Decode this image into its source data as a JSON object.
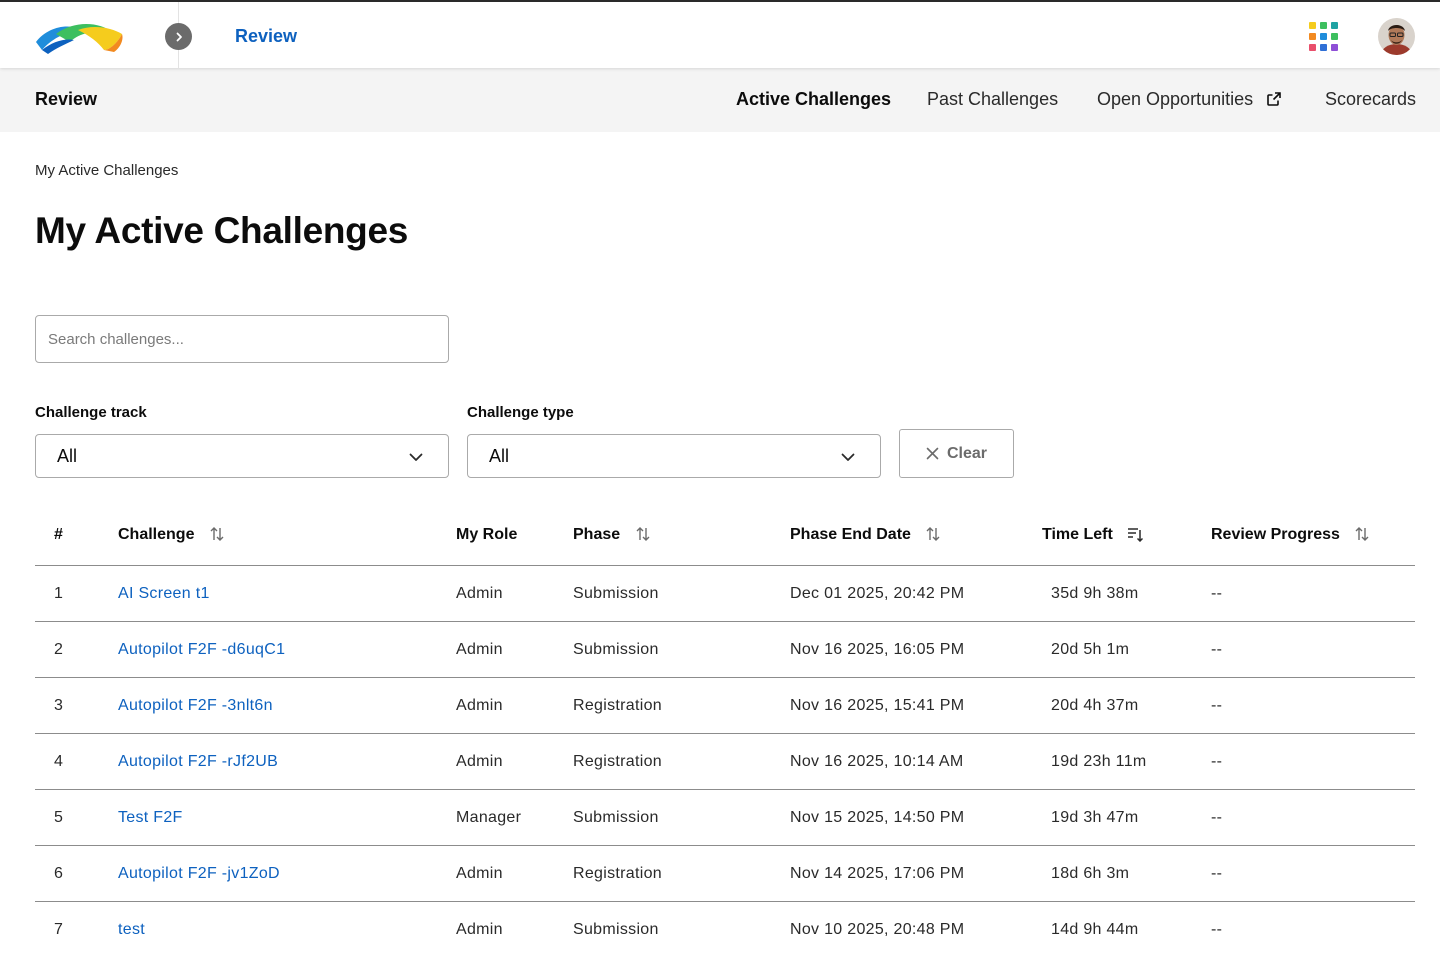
{
  "header": {
    "app_name": "Review",
    "logo": "topcoder-logo",
    "collapse_icon": "chevron-right-icon",
    "apps_icon": "apps-grid-icon",
    "avatar": "user-avatar"
  },
  "subnav": {
    "title": "Review",
    "items": [
      {
        "label": "Active Challenges",
        "active": true
      },
      {
        "label": "Past Challenges",
        "active": false
      },
      {
        "label": "Open Opportunities",
        "active": false,
        "icon": "external-link-icon"
      },
      {
        "label": "Scorecards",
        "active": false
      }
    ]
  },
  "breadcrumb": "My Active Challenges",
  "page_title": "My Active Challenges",
  "search": {
    "placeholder": "Search challenges...",
    "value": ""
  },
  "filters": {
    "track": {
      "label": "Challenge track",
      "value": "All"
    },
    "type": {
      "label": "Challenge type",
      "value": "All"
    },
    "clear_label": "Clear"
  },
  "table": {
    "columns": [
      "#",
      "Challenge",
      "My Role",
      "Phase",
      "Phase End Date",
      "Time Left",
      "Review Progress"
    ],
    "rows": [
      {
        "num": "1",
        "challenge": "AI Screen t1",
        "role": "Admin",
        "phase": "Submission",
        "end": "Dec 01 2025, 20:42 PM",
        "left": "35d 9h 38m",
        "progress": "--"
      },
      {
        "num": "2",
        "challenge": "Autopilot F2F -d6uqC1",
        "role": "Admin",
        "phase": "Submission",
        "end": "Nov 16 2025, 16:05 PM",
        "left": "20d 5h 1m",
        "progress": "--"
      },
      {
        "num": "3",
        "challenge": "Autopilot F2F -3nlt6n",
        "role": "Admin",
        "phase": "Registration",
        "end": "Nov 16 2025, 15:41 PM",
        "left": "20d 4h 37m",
        "progress": "--"
      },
      {
        "num": "4",
        "challenge": "Autopilot F2F -rJf2UB",
        "role": "Admin",
        "phase": "Registration",
        "end": "Nov 16 2025, 10:14 AM",
        "left": "19d 23h 11m",
        "progress": "--"
      },
      {
        "num": "5",
        "challenge": "Test F2F",
        "role": "Manager",
        "phase": "Submission",
        "end": "Nov 15 2025, 14:50 PM",
        "left": "19d 3h 47m",
        "progress": "--"
      },
      {
        "num": "6",
        "challenge": "Autopilot F2F -jv1ZoD",
        "role": "Admin",
        "phase": "Registration",
        "end": "Nov 14 2025, 17:06 PM",
        "left": "18d 6h 3m",
        "progress": "--"
      },
      {
        "num": "7",
        "challenge": "test",
        "role": "Admin",
        "phase": "Submission",
        "end": "Nov 10 2025, 20:48 PM",
        "left": "14d 9h 44m",
        "progress": "--"
      }
    ]
  },
  "colors": {
    "link": "#0d61bf",
    "text": "#2a2a2a",
    "subnav_bg": "#f4f4f4"
  }
}
